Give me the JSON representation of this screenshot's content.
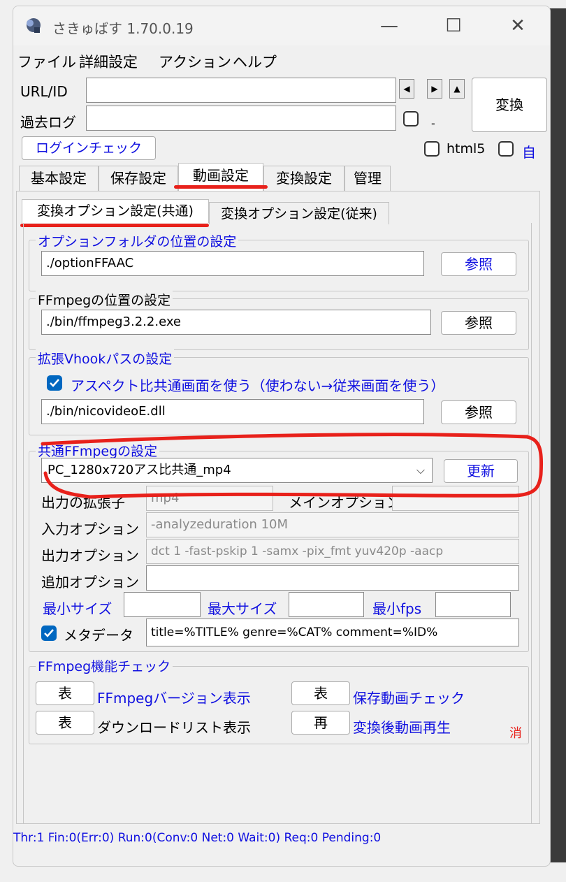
{
  "window": {
    "title": "さきゅばす 1.70.0.19",
    "minimize": "—",
    "maximize": "☐",
    "close": "✕"
  },
  "menu": [
    "ファイル",
    "詳細設定",
    "アクション",
    "ヘルプ"
  ],
  "url": {
    "label": "URL/ID",
    "value": ""
  },
  "past_log": {
    "label": "過去ログ",
    "value": "",
    "dash": "-"
  },
  "nav": {
    "left": "◀",
    "right": "▶",
    "up": "▲"
  },
  "convert_button": "変換",
  "login_check_button": "ログインチェック",
  "html5_label": "html5",
  "auto_label": "自",
  "tabs": [
    "基本設定",
    "保存設定",
    "動画設定",
    "変換設定",
    "管理"
  ],
  "subtabs": [
    "変換オプション設定(共通)",
    "変換オプション設定(従来)"
  ],
  "option_folder": {
    "legend": "オプションフォルダの位置の設定",
    "value": "./optionFFAAC",
    "button": "参照"
  },
  "ffmpeg_path": {
    "legend": "FFmpegの位置の設定",
    "value": "./bin/ffmpeg3.2.2.exe",
    "button": "参照"
  },
  "vhook": {
    "legend": "拡張Vhookパスの設定",
    "checkbox_label": "アスペクト比共通画面を使う（使わない→従来画面を使う）",
    "value": "./bin/nicovideoE.dll",
    "button": "参照"
  },
  "common_ffmpeg": {
    "legend": "共通FFmpegの設定",
    "selected": "PC_1280x720アス比共通_mp4",
    "update_button": "更新",
    "ext_label": "出力の拡張子",
    "ext_value": "mp4",
    "main_option_label": "メインオプション",
    "main_option_value": "",
    "input_label": "入力オプション",
    "input_value": "-analyzeduration 10M",
    "output_label": "出力オプション",
    "output_value": "dct 1 -fast-pskip 1 -samx -pix_fmt yuv420p -aacp",
    "extra_label": "追加オプション",
    "extra_value": "",
    "min_size_label": "最小サイズ",
    "max_size_label": "最大サイズ",
    "min_fps_label": "最小fps",
    "metadata_label": "メタデータ",
    "metadata_value": "title=%TITLE% genre=%CAT% comment=%ID%"
  },
  "ffmpeg_check": {
    "legend": "FFmpeg機能チェック",
    "btn1": "表",
    "label1": "FFmpegバージョン表示",
    "btn2": "表",
    "label2": "保存動画チェック",
    "btn3": "表",
    "label3": "ダウンロードリスト表示",
    "btn4": "再",
    "label4": "変換後動画再生",
    "erase": "消"
  },
  "status": "Thr:1 Fin:0(Err:0) Run:0(Conv:0 Net:0 Wait:0) Req:0 Pending:0",
  "colors": {
    "accent": "#1010e0",
    "check": "#0067c0",
    "highlight": "#e8211b"
  }
}
